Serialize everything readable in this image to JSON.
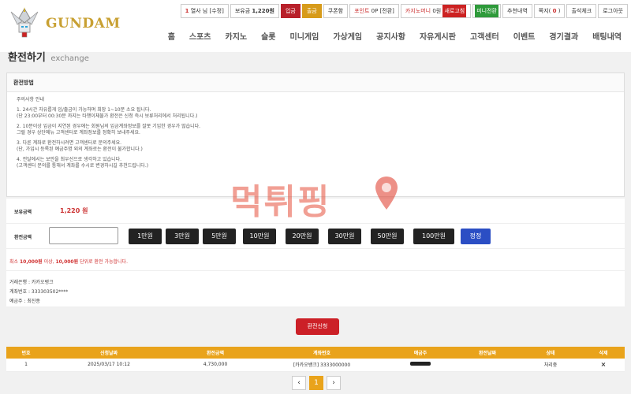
{
  "header": {
    "logo_text": "GUNDAM",
    "userbar": {
      "level": "1",
      "user": "열사 님 [수정]",
      "balance_label": "보유금",
      "balance": "1,220원",
      "deposit": "입금",
      "withdraw": "출금",
      "coupon": "쿠폰함",
      "point_label": "포인트",
      "point": "0P [전환]",
      "casino_label": "카지노머니",
      "casino_value": "0원",
      "casino_tag": "새로고침",
      "mini_tag": "미니전환",
      "recommend": "추천내역",
      "message_label": "쪽지",
      "message_count": "0",
      "attendance": "출석체크",
      "logout": "로그아웃"
    },
    "nav": [
      "홈",
      "스포츠",
      "카지노",
      "슬롯",
      "미니게임",
      "가상게임",
      "공지사항",
      "자유게시판",
      "고객센터",
      "이벤트",
      "경기결과",
      "배팅내역"
    ]
  },
  "page": {
    "title": "환전하기",
    "subtitle": "exchange"
  },
  "method": {
    "heading": "환전방법",
    "notice_title": "주의사항 안내",
    "lines": [
      "1. 24시간 자유롭게 입/출금이 가능하며 최장 1~10분 소요 됩니다.",
      "(단 23:00부터 00:30분 까지는 타행이체불가 환전은 신청 즉시 보류처리에서 처리됩니다.)",
      "2. 10분이상 입금이 지연된 경우에는 회원님의 입금계좌정보를 잘못 기입한 경우가 많습니다.",
      "그럴 경우 상단메뉴 고객센터로 계좌정보를 정확히 보내주세요.",
      "3. 다른 계좌로 환전하시려면 고객센터로 문의주세요.",
      "(단, 가입시 등록된 예금주명 외의 계좌로는 환전이 불가합니다.)",
      "4. 전달에서는 보안을 최우선으로 생각하고 있습니다.",
      "(고객센터 문의를 통해서 계좌를 수시로 변경하시길 추천드립니다.)"
    ]
  },
  "form": {
    "balance_label": "보유금액",
    "balance_value": "1,220 원",
    "amount_label": "환전금액",
    "amount_value": "",
    "buttons": [
      "1만원",
      "3만원",
      "5만원",
      "10만원",
      "20만원",
      "30만원",
      "50만원",
      "100만원"
    ],
    "reset": "정정",
    "limit_prefix": "최소",
    "limit_min": "10,000원",
    "limit_mid": "이상,",
    "limit_unit": "10,000원",
    "limit_suffix": "단위로 환전 가능합니다.",
    "bank": "거래은행 : 카카오뱅크",
    "account": "계좌번호 : 333303502****",
    "holder": "예금주 : 최진종",
    "submit": "환전신청"
  },
  "table": {
    "headers": [
      "번호",
      "신청날짜",
      "환전금액",
      "계좌번호",
      "예금주",
      "환전날짜",
      "상태",
      "삭제"
    ],
    "rows": [
      [
        "1",
        "2025/03/17 10:12",
        "4,730,000",
        "[카카오뱅크] 3333000000",
        "",
        "",
        "처리중",
        "×"
      ]
    ]
  },
  "pager": {
    "prev": "‹",
    "current": "1",
    "next": "›"
  },
  "watermark": "먹튀핑"
}
